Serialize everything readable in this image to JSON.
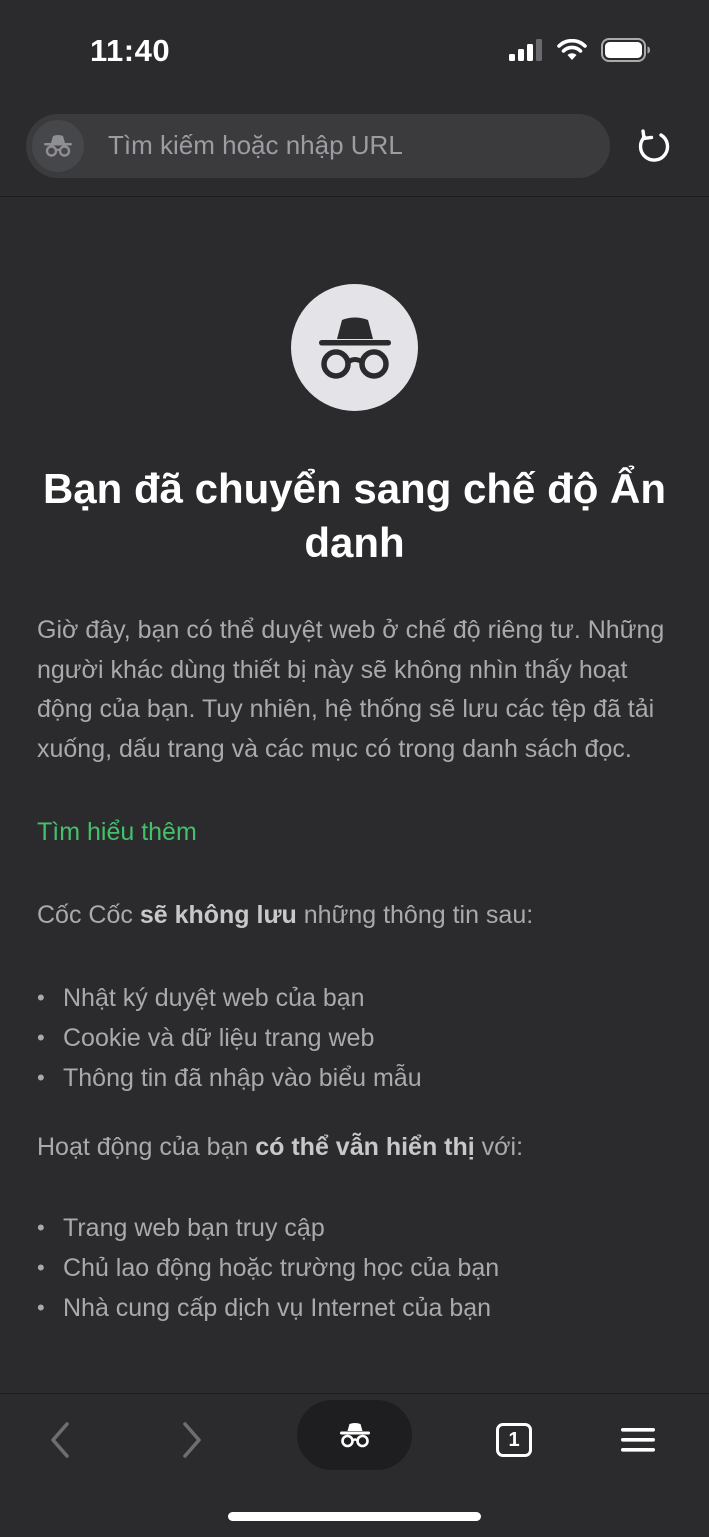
{
  "status": {
    "time": "11:40"
  },
  "toolbar": {
    "url_placeholder": "Tìm kiếm hoặc nhập URL"
  },
  "main": {
    "title": "Bạn đã chuyển sang chế độ Ẩn danh",
    "intro": "Giờ đây, bạn có thể duyệt web ở chế độ riêng tư. Những người khác dùng thiết bị này sẽ không nhìn thấy hoạt động của bạn. Tuy nhiên, hệ thống sẽ lưu các tệp đã tải xuống, dấu trang và các mục có trong danh sách đọc.",
    "learn_more": "Tìm hiểu thêm",
    "not_saved": {
      "prefix": "Cốc Cốc ",
      "bold": "sẽ không lưu",
      "suffix": " những thông tin sau:"
    },
    "not_saved_items": [
      "Nhật ký duyệt web của bạn",
      "Cookie và dữ liệu trang web",
      "Thông tin đã nhập vào biểu mẫu"
    ],
    "visible": {
      "prefix": "Hoạt động của bạn ",
      "bold": "có thể vẫn hiển thị",
      "suffix": " với:"
    },
    "visible_items": [
      "Trang web bạn truy cập",
      "Chủ lao động hoặc trường học của bạn",
      "Nhà cung cấp dịch vụ Internet của bạn"
    ]
  },
  "bottom": {
    "tab_count": "1"
  },
  "colors": {
    "background": "#2b2b2d",
    "link": "#45c06a",
    "url_field": "#3b3b3e"
  }
}
